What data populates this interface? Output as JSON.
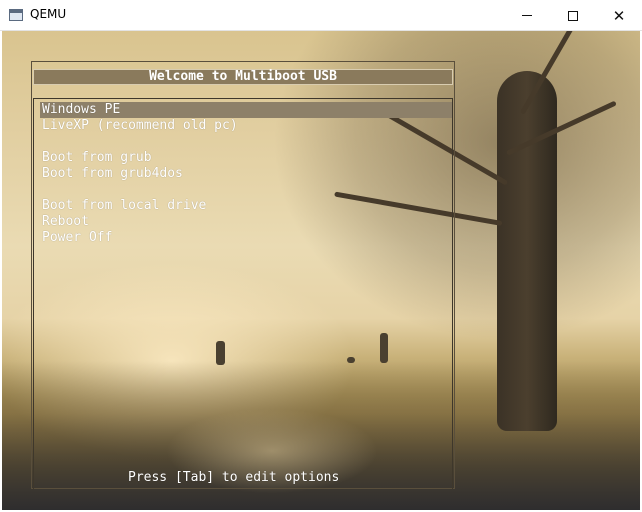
{
  "window": {
    "title": "QEMU",
    "controls": {
      "minimize": "minimize",
      "maximize": "maximize",
      "close": "✕"
    }
  },
  "boot_menu": {
    "header": "Welcome to Multiboot USB",
    "selected_index": 0,
    "items": [
      {
        "label": "Windows PE"
      },
      {
        "label": "LiveXP (recommend old pc)"
      },
      {
        "label": "Boot from grub"
      },
      {
        "label": "Boot from grub4dos"
      },
      {
        "label": "Boot from local drive"
      },
      {
        "label": "Reboot"
      },
      {
        "label": "Power Off"
      }
    ],
    "hint": "Press [Tab] to edit options"
  },
  "colors": {
    "highlight": "#8d8069",
    "text": "#ffffff",
    "header_bg": "#8a7a5c"
  },
  "background": {
    "icons": [
      "tree-icon",
      "walking-figure-icon",
      "dog-icon"
    ]
  }
}
